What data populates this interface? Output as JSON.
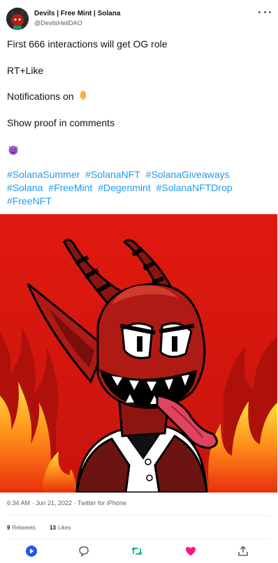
{
  "author": {
    "display_name": "Devils | Free Mint | Solana",
    "handle": "@DevilsHellDAO"
  },
  "tweet": {
    "line1": "First 666 interactions will get OG role",
    "line2": "RT+Like",
    "line3": "Notifications on",
    "line4": "Show proof in comments",
    "hashtags": [
      "#SolanaSummer",
      "#SolanaNFT",
      "#SolanaGiveaways",
      "#Solana",
      "#FreeMint",
      "#Degenmint",
      "#SolanaNFTDrop",
      "#FreeNFT"
    ]
  },
  "meta": {
    "timestamp": "6:34 AM · Jun 21, 2022",
    "separator": " · ",
    "source": "Twitter for iPhone"
  },
  "stats": {
    "retweets_count": "9",
    "retweets_label": "Retweets",
    "likes_count": "13",
    "likes_label": "Likes"
  },
  "colors": {
    "link": "#1d9bf0",
    "retweet": "#00ba7c",
    "like": "#f91880",
    "muted": "#536471"
  },
  "icons": {
    "more": "more-dots-icon",
    "bell": "bell-emoji",
    "devil": "smiling-devil-emoji",
    "reply": "reply-icon",
    "retweet": "retweet-icon",
    "like": "heart-icon",
    "share": "share-icon",
    "spaces": "play-badge-icon"
  }
}
